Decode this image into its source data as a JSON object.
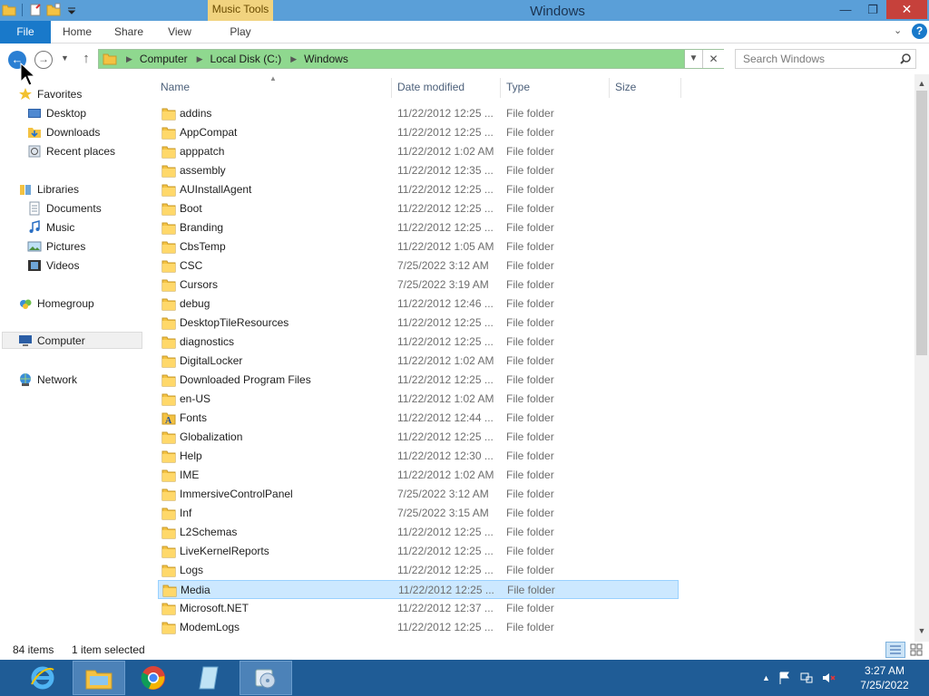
{
  "window": {
    "title": "Windows",
    "context_tab": "Music Tools",
    "min_glyph": "—",
    "max_glyph": "❐",
    "close_glyph": "✕"
  },
  "ribbon": {
    "file": "File",
    "home": "Home",
    "share": "Share",
    "view": "View",
    "play": "Play",
    "help": "?"
  },
  "address": {
    "crumbs": [
      "Computer",
      "Local Disk (C:)",
      "Windows"
    ],
    "search_placeholder": "Search Windows"
  },
  "nav_pane": {
    "favorites": "Favorites",
    "desktop": "Desktop",
    "downloads": "Downloads",
    "recent_places": "Recent places",
    "libraries": "Libraries",
    "documents": "Documents",
    "music": "Music",
    "pictures": "Pictures",
    "videos": "Videos",
    "homegroup": "Homegroup",
    "computer": "Computer",
    "network": "Network"
  },
  "columns": {
    "name": "Name",
    "date": "Date modified",
    "type": "Type",
    "size": "Size"
  },
  "files": [
    {
      "name": "addins",
      "date": "11/22/2012 12:25 ...",
      "type": "File folder"
    },
    {
      "name": "AppCompat",
      "date": "11/22/2012 12:25 ...",
      "type": "File folder"
    },
    {
      "name": "apppatch",
      "date": "11/22/2012 1:02 AM",
      "type": "File folder"
    },
    {
      "name": "assembly",
      "date": "11/22/2012 12:35 ...",
      "type": "File folder"
    },
    {
      "name": "AUInstallAgent",
      "date": "11/22/2012 12:25 ...",
      "type": "File folder"
    },
    {
      "name": "Boot",
      "date": "11/22/2012 12:25 ...",
      "type": "File folder"
    },
    {
      "name": "Branding",
      "date": "11/22/2012 12:25 ...",
      "type": "File folder"
    },
    {
      "name": "CbsTemp",
      "date": "11/22/2012 1:05 AM",
      "type": "File folder"
    },
    {
      "name": "CSC",
      "date": "7/25/2022 3:12 AM",
      "type": "File folder"
    },
    {
      "name": "Cursors",
      "date": "7/25/2022 3:19 AM",
      "type": "File folder"
    },
    {
      "name": "debug",
      "date": "11/22/2012 12:46 ...",
      "type": "File folder"
    },
    {
      "name": "DesktopTileResources",
      "date": "11/22/2012 12:25 ...",
      "type": "File folder"
    },
    {
      "name": "diagnostics",
      "date": "11/22/2012 12:25 ...",
      "type": "File folder"
    },
    {
      "name": "DigitalLocker",
      "date": "11/22/2012 1:02 AM",
      "type": "File folder"
    },
    {
      "name": "Downloaded Program Files",
      "date": "11/22/2012 12:25 ...",
      "type": "File folder"
    },
    {
      "name": "en-US",
      "date": "11/22/2012 1:02 AM",
      "type": "File folder"
    },
    {
      "name": "Fonts",
      "date": "11/22/2012 12:44 ...",
      "type": "File folder",
      "icon": "fonts"
    },
    {
      "name": "Globalization",
      "date": "11/22/2012 12:25 ...",
      "type": "File folder"
    },
    {
      "name": "Help",
      "date": "11/22/2012 12:30 ...",
      "type": "File folder"
    },
    {
      "name": "IME",
      "date": "11/22/2012 1:02 AM",
      "type": "File folder"
    },
    {
      "name": "ImmersiveControlPanel",
      "date": "7/25/2022 3:12 AM",
      "type": "File folder"
    },
    {
      "name": "Inf",
      "date": "7/25/2022 3:15 AM",
      "type": "File folder"
    },
    {
      "name": "L2Schemas",
      "date": "11/22/2012 12:25 ...",
      "type": "File folder"
    },
    {
      "name": "LiveKernelReports",
      "date": "11/22/2012 12:25 ...",
      "type": "File folder"
    },
    {
      "name": "Logs",
      "date": "11/22/2012 12:25 ...",
      "type": "File folder"
    },
    {
      "name": "Media",
      "date": "11/22/2012 12:25 ...",
      "type": "File folder",
      "selected": true
    },
    {
      "name": "Microsoft.NET",
      "date": "11/22/2012 12:37 ...",
      "type": "File folder"
    },
    {
      "name": "ModemLogs",
      "date": "11/22/2012 12:25 ...",
      "type": "File folder"
    }
  ],
  "status": {
    "item_count": "84 items",
    "selection": "1 item selected"
  },
  "clock": {
    "time": "3:27 AM",
    "date": "7/25/2022"
  },
  "colors": {
    "titlebar": "#5a9fd8",
    "file_tab": "#1979ca",
    "address_fill": "#8fd88f",
    "selection": "#cce8ff",
    "taskbar": "#1f5c96"
  }
}
